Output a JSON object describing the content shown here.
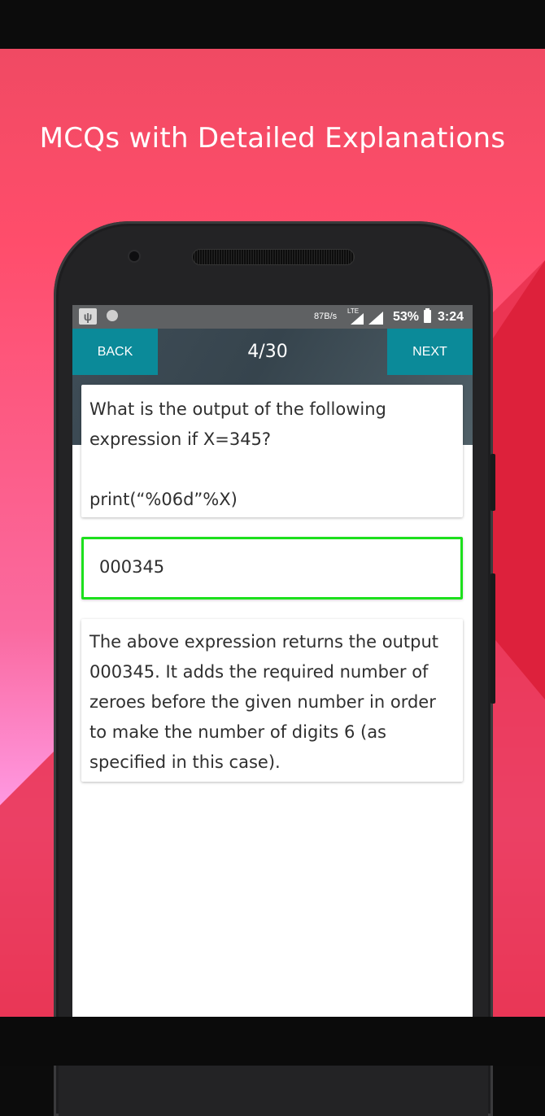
{
  "headline": "MCQs with Detailed Explanations",
  "status_bar": {
    "speed": "87B/s",
    "network": "LTE",
    "battery": "53%",
    "time": "3:24"
  },
  "toolbar": {
    "back_label": "BACK",
    "counter": "4/30",
    "next_label": "NEXT"
  },
  "question": {
    "text": "What is the output of the following\nexpression if X=345?\n\nprint(“%06d”%X)"
  },
  "answer": {
    "text": "000345",
    "state": "correct"
  },
  "explanation": {
    "text": "The above expression returns the output 000345. It adds the required number of zeroes before the given number in order to make the number of digits 6 (as specified in this case)."
  },
  "colors": {
    "accent": "#0b8a99",
    "correct_border": "#1de01d",
    "background_start": "#f04a63",
    "background_end": "#ff9de8"
  },
  "icons": [
    "usb-icon",
    "notification-dot-icon",
    "signal-icon",
    "battery-icon"
  ]
}
